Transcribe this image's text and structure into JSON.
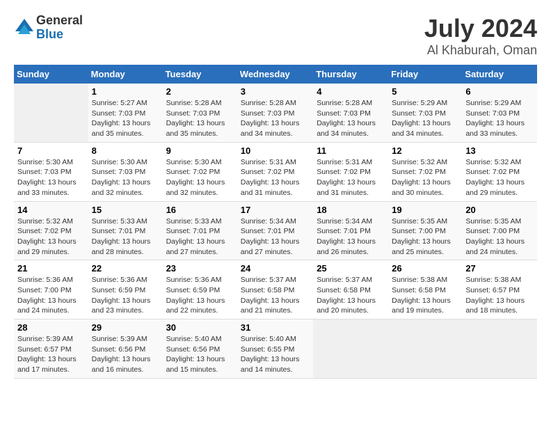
{
  "logo": {
    "general": "General",
    "blue": "Blue"
  },
  "title": {
    "month": "July 2024",
    "location": "Al Khaburah, Oman"
  },
  "weekdays": [
    "Sunday",
    "Monday",
    "Tuesday",
    "Wednesday",
    "Thursday",
    "Friday",
    "Saturday"
  ],
  "weeks": [
    [
      {
        "day": "",
        "empty": true
      },
      {
        "day": "1",
        "sunrise": "5:27 AM",
        "sunset": "7:03 PM",
        "daylight": "13 hours and 35 minutes."
      },
      {
        "day": "2",
        "sunrise": "5:28 AM",
        "sunset": "7:03 PM",
        "daylight": "13 hours and 35 minutes."
      },
      {
        "day": "3",
        "sunrise": "5:28 AM",
        "sunset": "7:03 PM",
        "daylight": "13 hours and 34 minutes."
      },
      {
        "day": "4",
        "sunrise": "5:28 AM",
        "sunset": "7:03 PM",
        "daylight": "13 hours and 34 minutes."
      },
      {
        "day": "5",
        "sunrise": "5:29 AM",
        "sunset": "7:03 PM",
        "daylight": "13 hours and 34 minutes."
      },
      {
        "day": "6",
        "sunrise": "5:29 AM",
        "sunset": "7:03 PM",
        "daylight": "13 hours and 33 minutes."
      }
    ],
    [
      {
        "day": "7",
        "sunrise": "5:30 AM",
        "sunset": "7:03 PM",
        "daylight": "13 hours and 33 minutes."
      },
      {
        "day": "8",
        "sunrise": "5:30 AM",
        "sunset": "7:03 PM",
        "daylight": "13 hours and 32 minutes."
      },
      {
        "day": "9",
        "sunrise": "5:30 AM",
        "sunset": "7:02 PM",
        "daylight": "13 hours and 32 minutes."
      },
      {
        "day": "10",
        "sunrise": "5:31 AM",
        "sunset": "7:02 PM",
        "daylight": "13 hours and 31 minutes."
      },
      {
        "day": "11",
        "sunrise": "5:31 AM",
        "sunset": "7:02 PM",
        "daylight": "13 hours and 31 minutes."
      },
      {
        "day": "12",
        "sunrise": "5:32 AM",
        "sunset": "7:02 PM",
        "daylight": "13 hours and 30 minutes."
      },
      {
        "day": "13",
        "sunrise": "5:32 AM",
        "sunset": "7:02 PM",
        "daylight": "13 hours and 29 minutes."
      }
    ],
    [
      {
        "day": "14",
        "sunrise": "5:32 AM",
        "sunset": "7:02 PM",
        "daylight": "13 hours and 29 minutes."
      },
      {
        "day": "15",
        "sunrise": "5:33 AM",
        "sunset": "7:01 PM",
        "daylight": "13 hours and 28 minutes."
      },
      {
        "day": "16",
        "sunrise": "5:33 AM",
        "sunset": "7:01 PM",
        "daylight": "13 hours and 27 minutes."
      },
      {
        "day": "17",
        "sunrise": "5:34 AM",
        "sunset": "7:01 PM",
        "daylight": "13 hours and 27 minutes."
      },
      {
        "day": "18",
        "sunrise": "5:34 AM",
        "sunset": "7:01 PM",
        "daylight": "13 hours and 26 minutes."
      },
      {
        "day": "19",
        "sunrise": "5:35 AM",
        "sunset": "7:00 PM",
        "daylight": "13 hours and 25 minutes."
      },
      {
        "day": "20",
        "sunrise": "5:35 AM",
        "sunset": "7:00 PM",
        "daylight": "13 hours and 24 minutes."
      }
    ],
    [
      {
        "day": "21",
        "sunrise": "5:36 AM",
        "sunset": "7:00 PM",
        "daylight": "13 hours and 24 minutes."
      },
      {
        "day": "22",
        "sunrise": "5:36 AM",
        "sunset": "6:59 PM",
        "daylight": "13 hours and 23 minutes."
      },
      {
        "day": "23",
        "sunrise": "5:36 AM",
        "sunset": "6:59 PM",
        "daylight": "13 hours and 22 minutes."
      },
      {
        "day": "24",
        "sunrise": "5:37 AM",
        "sunset": "6:58 PM",
        "daylight": "13 hours and 21 minutes."
      },
      {
        "day": "25",
        "sunrise": "5:37 AM",
        "sunset": "6:58 PM",
        "daylight": "13 hours and 20 minutes."
      },
      {
        "day": "26",
        "sunrise": "5:38 AM",
        "sunset": "6:58 PM",
        "daylight": "13 hours and 19 minutes."
      },
      {
        "day": "27",
        "sunrise": "5:38 AM",
        "sunset": "6:57 PM",
        "daylight": "13 hours and 18 minutes."
      }
    ],
    [
      {
        "day": "28",
        "sunrise": "5:39 AM",
        "sunset": "6:57 PM",
        "daylight": "13 hours and 17 minutes."
      },
      {
        "day": "29",
        "sunrise": "5:39 AM",
        "sunset": "6:56 PM",
        "daylight": "13 hours and 16 minutes."
      },
      {
        "day": "30",
        "sunrise": "5:40 AM",
        "sunset": "6:56 PM",
        "daylight": "13 hours and 15 minutes."
      },
      {
        "day": "31",
        "sunrise": "5:40 AM",
        "sunset": "6:55 PM",
        "daylight": "13 hours and 14 minutes."
      },
      {
        "day": "",
        "empty": true
      },
      {
        "day": "",
        "empty": true
      },
      {
        "day": "",
        "empty": true
      }
    ]
  ],
  "labels": {
    "sunrise": "Sunrise:",
    "sunset": "Sunset:",
    "daylight": "Daylight:"
  }
}
